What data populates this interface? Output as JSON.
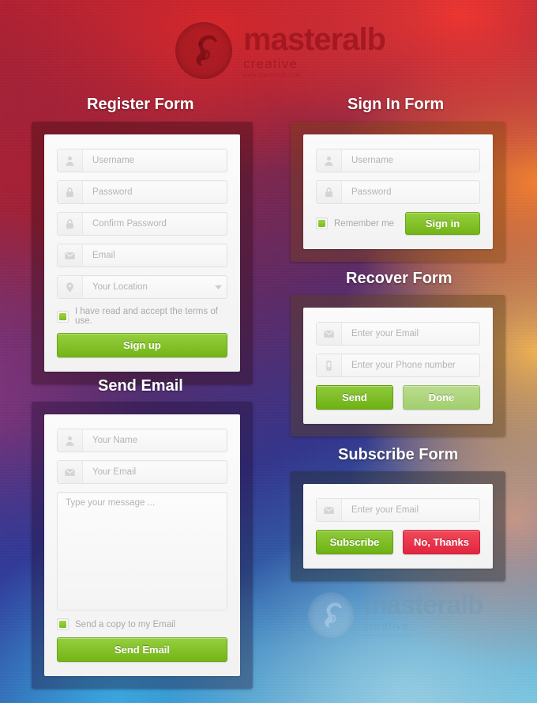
{
  "brand": {
    "name": "masteralb",
    "tagline": "creative",
    "url": "www.masteralb.com",
    "logo_icon": "seahorse-circle-logo"
  },
  "colors": {
    "green": "#7FC224",
    "green_pale": "#AFD57F",
    "red": "#E8293F",
    "title_text": "#FFFFFF",
    "placeholder": "#B4B4B4"
  },
  "register_form": {
    "title": "Register Form",
    "fields": [
      {
        "icon": "user-icon",
        "placeholder": "Username"
      },
      {
        "icon": "lock-icon",
        "placeholder": "Password"
      },
      {
        "icon": "lock-icon",
        "placeholder": "Confirm Password"
      },
      {
        "icon": "envelope-icon",
        "placeholder": "Email"
      },
      {
        "icon": "map-pin-icon",
        "placeholder": "Your Location",
        "dropdown": true
      }
    ],
    "terms_label": "I have read and accept the terms of use.",
    "terms_checked": true,
    "submit_label": "Sign up"
  },
  "send_email_form": {
    "title": "Send Email",
    "fields": [
      {
        "icon": "user-icon",
        "placeholder": "Your Name"
      },
      {
        "icon": "envelope-icon",
        "placeholder": "Your Email"
      }
    ],
    "message_placeholder": "Type your message ...",
    "copy_label": "Send a copy to my Email",
    "copy_checked": true,
    "submit_label": "Send Email"
  },
  "signin_form": {
    "title": "Sign In Form",
    "fields": [
      {
        "icon": "user-icon",
        "placeholder": "Username"
      },
      {
        "icon": "lock-icon",
        "placeholder": "Password"
      }
    ],
    "remember_label": "Remember me",
    "remember_checked": true,
    "submit_label": "Sign in"
  },
  "recover_form": {
    "title": "Recover Form",
    "fields": [
      {
        "icon": "envelope-icon",
        "placeholder": "Enter your Email"
      },
      {
        "icon": "phone-icon",
        "placeholder": "Enter your Phone number"
      }
    ],
    "send_label": "Send",
    "done_label": "Done"
  },
  "subscribe_form": {
    "title": "Subscribe Form",
    "fields": [
      {
        "icon": "envelope-icon",
        "placeholder": "Enter your Email"
      }
    ],
    "subscribe_label": "Subscribe",
    "decline_label": "No, Thanks"
  }
}
